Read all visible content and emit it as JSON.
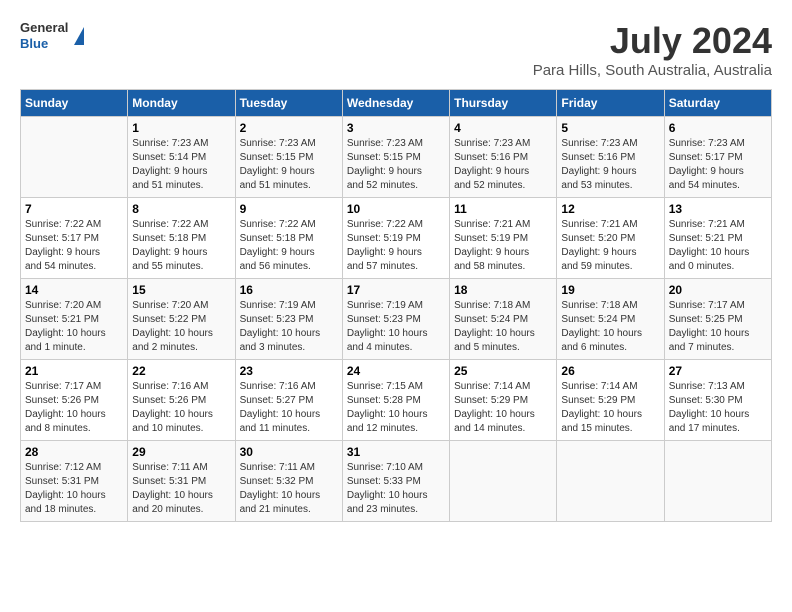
{
  "header": {
    "logo": {
      "line1": "General",
      "line2": "Blue"
    },
    "title": "July 2024",
    "location": "Para Hills, South Australia, Australia"
  },
  "days_of_week": [
    "Sunday",
    "Monday",
    "Tuesday",
    "Wednesday",
    "Thursday",
    "Friday",
    "Saturday"
  ],
  "weeks": [
    [
      {
        "day": "",
        "info": ""
      },
      {
        "day": "1",
        "info": "Sunrise: 7:23 AM\nSunset: 5:14 PM\nDaylight: 9 hours\nand 51 minutes."
      },
      {
        "day": "2",
        "info": "Sunrise: 7:23 AM\nSunset: 5:15 PM\nDaylight: 9 hours\nand 51 minutes."
      },
      {
        "day": "3",
        "info": "Sunrise: 7:23 AM\nSunset: 5:15 PM\nDaylight: 9 hours\nand 52 minutes."
      },
      {
        "day": "4",
        "info": "Sunrise: 7:23 AM\nSunset: 5:16 PM\nDaylight: 9 hours\nand 52 minutes."
      },
      {
        "day": "5",
        "info": "Sunrise: 7:23 AM\nSunset: 5:16 PM\nDaylight: 9 hours\nand 53 minutes."
      },
      {
        "day": "6",
        "info": "Sunrise: 7:23 AM\nSunset: 5:17 PM\nDaylight: 9 hours\nand 54 minutes."
      }
    ],
    [
      {
        "day": "7",
        "info": "Sunrise: 7:22 AM\nSunset: 5:17 PM\nDaylight: 9 hours\nand 54 minutes."
      },
      {
        "day": "8",
        "info": "Sunrise: 7:22 AM\nSunset: 5:18 PM\nDaylight: 9 hours\nand 55 minutes."
      },
      {
        "day": "9",
        "info": "Sunrise: 7:22 AM\nSunset: 5:18 PM\nDaylight: 9 hours\nand 56 minutes."
      },
      {
        "day": "10",
        "info": "Sunrise: 7:22 AM\nSunset: 5:19 PM\nDaylight: 9 hours\nand 57 minutes."
      },
      {
        "day": "11",
        "info": "Sunrise: 7:21 AM\nSunset: 5:19 PM\nDaylight: 9 hours\nand 58 minutes."
      },
      {
        "day": "12",
        "info": "Sunrise: 7:21 AM\nSunset: 5:20 PM\nDaylight: 9 hours\nand 59 minutes."
      },
      {
        "day": "13",
        "info": "Sunrise: 7:21 AM\nSunset: 5:21 PM\nDaylight: 10 hours\nand 0 minutes."
      }
    ],
    [
      {
        "day": "14",
        "info": "Sunrise: 7:20 AM\nSunset: 5:21 PM\nDaylight: 10 hours\nand 1 minute."
      },
      {
        "day": "15",
        "info": "Sunrise: 7:20 AM\nSunset: 5:22 PM\nDaylight: 10 hours\nand 2 minutes."
      },
      {
        "day": "16",
        "info": "Sunrise: 7:19 AM\nSunset: 5:23 PM\nDaylight: 10 hours\nand 3 minutes."
      },
      {
        "day": "17",
        "info": "Sunrise: 7:19 AM\nSunset: 5:23 PM\nDaylight: 10 hours\nand 4 minutes."
      },
      {
        "day": "18",
        "info": "Sunrise: 7:18 AM\nSunset: 5:24 PM\nDaylight: 10 hours\nand 5 minutes."
      },
      {
        "day": "19",
        "info": "Sunrise: 7:18 AM\nSunset: 5:24 PM\nDaylight: 10 hours\nand 6 minutes."
      },
      {
        "day": "20",
        "info": "Sunrise: 7:17 AM\nSunset: 5:25 PM\nDaylight: 10 hours\nand 7 minutes."
      }
    ],
    [
      {
        "day": "21",
        "info": "Sunrise: 7:17 AM\nSunset: 5:26 PM\nDaylight: 10 hours\nand 8 minutes."
      },
      {
        "day": "22",
        "info": "Sunrise: 7:16 AM\nSunset: 5:26 PM\nDaylight: 10 hours\nand 10 minutes."
      },
      {
        "day": "23",
        "info": "Sunrise: 7:16 AM\nSunset: 5:27 PM\nDaylight: 10 hours\nand 11 minutes."
      },
      {
        "day": "24",
        "info": "Sunrise: 7:15 AM\nSunset: 5:28 PM\nDaylight: 10 hours\nand 12 minutes."
      },
      {
        "day": "25",
        "info": "Sunrise: 7:14 AM\nSunset: 5:29 PM\nDaylight: 10 hours\nand 14 minutes."
      },
      {
        "day": "26",
        "info": "Sunrise: 7:14 AM\nSunset: 5:29 PM\nDaylight: 10 hours\nand 15 minutes."
      },
      {
        "day": "27",
        "info": "Sunrise: 7:13 AM\nSunset: 5:30 PM\nDaylight: 10 hours\nand 17 minutes."
      }
    ],
    [
      {
        "day": "28",
        "info": "Sunrise: 7:12 AM\nSunset: 5:31 PM\nDaylight: 10 hours\nand 18 minutes."
      },
      {
        "day": "29",
        "info": "Sunrise: 7:11 AM\nSunset: 5:31 PM\nDaylight: 10 hours\nand 20 minutes."
      },
      {
        "day": "30",
        "info": "Sunrise: 7:11 AM\nSunset: 5:32 PM\nDaylight: 10 hours\nand 21 minutes."
      },
      {
        "day": "31",
        "info": "Sunrise: 7:10 AM\nSunset: 5:33 PM\nDaylight: 10 hours\nand 23 minutes."
      },
      {
        "day": "",
        "info": ""
      },
      {
        "day": "",
        "info": ""
      },
      {
        "day": "",
        "info": ""
      }
    ]
  ]
}
